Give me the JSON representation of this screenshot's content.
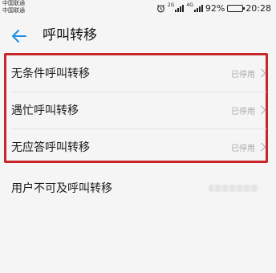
{
  "status_bar": {
    "carrier_1": "中国联通",
    "carrier_2": "中国联通",
    "network_1": "2G",
    "network_2": "4G",
    "battery_percent": "92%",
    "battery_level": 0.92,
    "time": "20:28",
    "icons": [
      "alarm-icon",
      "signal-icon",
      "signal-icon",
      "battery-icon"
    ]
  },
  "app_bar": {
    "back_icon": "arrow-left-icon",
    "title": "呼叫转移"
  },
  "settings": [
    {
      "label": "无条件呼叫转移",
      "value": "已停用"
    },
    {
      "label": "遇忙呼叫转移",
      "value": "已停用"
    },
    {
      "label": "无应答呼叫转移",
      "value": "已停用"
    },
    {
      "label": "用户不可及呼叫转移"
    }
  ],
  "colors": {
    "accent": "#1d8fe0",
    "highlight_border": "#c9262c",
    "battery_fill": "#33b24a",
    "background": "#f5f5f5"
  }
}
